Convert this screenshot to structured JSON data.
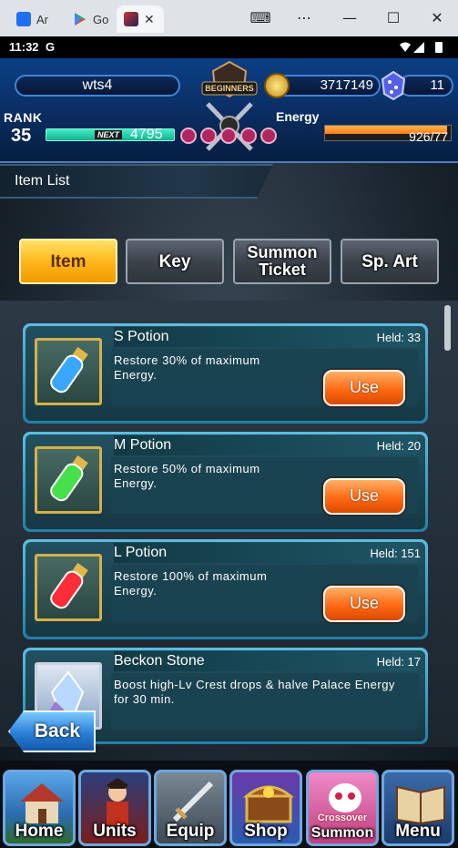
{
  "browser": {
    "tabs": [
      {
        "label": "Ar",
        "icon": "app-icon-blue"
      },
      {
        "label": "Go",
        "icon": "play-store-icon"
      },
      {
        "label": "",
        "icon": "game-icon"
      }
    ],
    "close_tab": "✕",
    "controls": {
      "keyboard": "⌨",
      "more": "⋯",
      "minimize": "—",
      "maximize": "☐",
      "close": "✕"
    }
  },
  "status_bar": {
    "time": "11:32",
    "carrier": "G"
  },
  "header": {
    "player_name": "wts4",
    "gold": "3717149",
    "gems": "11",
    "rank_label": "RANK",
    "rank": "35",
    "next_label": "NEXT",
    "next_exp": "4795",
    "energy_label": "Energy",
    "energy": "926/77",
    "energy_fill_fraction": 0.97,
    "emblem_text": "BEGINNERS"
  },
  "page_title": "Item List",
  "tabs": [
    {
      "label": "Item",
      "selected": true
    },
    {
      "label": "Key",
      "selected": false
    },
    {
      "label": "Summon Ticket",
      "selected": false
    },
    {
      "label": "Sp. Art",
      "selected": false
    }
  ],
  "items": [
    {
      "name": "S Potion",
      "held": "Held: 33",
      "desc": "Restore 30% of maximum Energy.",
      "use": "Use",
      "potion_color": "#3aa7ff"
    },
    {
      "name": "M Potion",
      "held": "Held: 20",
      "desc": "Restore 50% of maximum Energy.",
      "use": "Use",
      "potion_color": "#45e04a"
    },
    {
      "name": "L Potion",
      "held": "Held: 151",
      "desc": "Restore 100% of maximum Energy.",
      "use": "Use",
      "potion_color": "#ff2c3a"
    },
    {
      "name": "Beckon Stone",
      "held": "Held: 17",
      "desc": "Boost high-Lv Crest drops & halve Palace Energy for 30 min.",
      "use": "",
      "potion_color": "#b9d8ff"
    }
  ],
  "back_label": "Back",
  "nav": [
    {
      "label": "Home",
      "icon": "house-icon"
    },
    {
      "label": "Units",
      "icon": "hero-icon"
    },
    {
      "label": "Equip",
      "icon": "sword-icon"
    },
    {
      "label": "Shop",
      "icon": "treasure-chest-icon"
    },
    {
      "label": "Summon",
      "sub": "Crossover",
      "icon": "summon-creature-icon"
    },
    {
      "label": "Menu",
      "icon": "book-icon"
    }
  ],
  "colors": {
    "accent_tab": "#ffb81c",
    "use_button": "#ff6a14",
    "card_border": "#5bbfe0"
  }
}
